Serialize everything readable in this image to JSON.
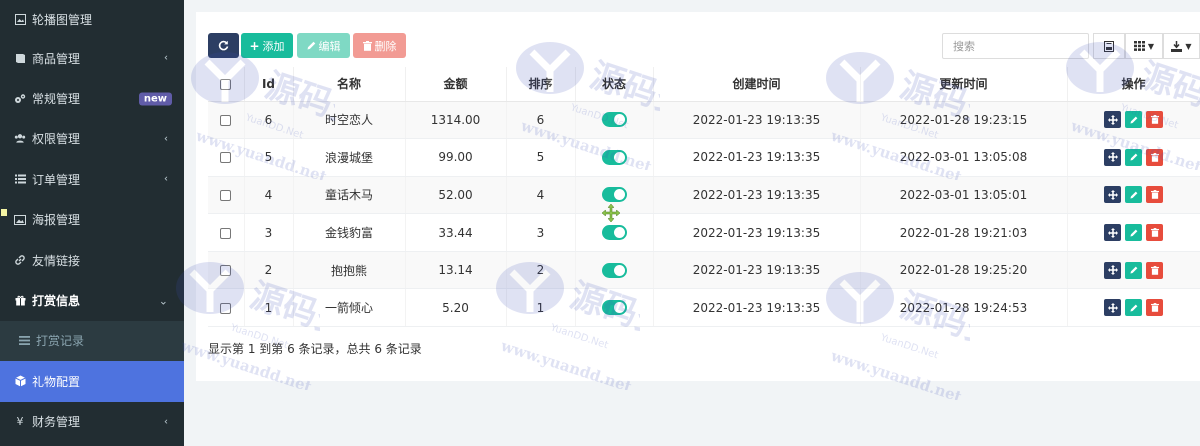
{
  "sidebar": {
    "items": [
      {
        "label": "轮播图管理",
        "icon": "image-icon",
        "chevron": false
      },
      {
        "label": "商品管理",
        "icon": "book-icon",
        "chevron": true
      },
      {
        "label": "常规管理",
        "icon": "gears-icon",
        "badge": "new"
      },
      {
        "label": "权限管理",
        "icon": "users-icon",
        "chevron": true
      },
      {
        "label": "订单管理",
        "icon": "list-icon",
        "chevron": true
      },
      {
        "label": "海报管理",
        "icon": "picture-icon",
        "chevron": false
      },
      {
        "label": "友情链接",
        "icon": "link-icon",
        "chevron": false
      },
      {
        "label": "打赏信息",
        "icon": "gift-icon",
        "chevron_down": true
      },
      {
        "label": "打赏记录",
        "icon": "list-icon"
      },
      {
        "label": "礼物配置",
        "icon": "cube-icon"
      },
      {
        "label": "财务管理",
        "icon": "yen-icon",
        "chevron": true
      }
    ]
  },
  "toolbar": {
    "add_label": "添加",
    "edit_label": "编辑",
    "delete_label": "删除",
    "search_placeholder": "搜索"
  },
  "table": {
    "columns": [
      "Id",
      "名称",
      "金额",
      "排序",
      "状态",
      "创建时间",
      "更新时间",
      "操作"
    ],
    "rows": [
      {
        "id": "6",
        "name": "时空恋人",
        "amount": "1314.00",
        "sort": "6",
        "status": true,
        "created": "2022-01-23 19:13:35",
        "updated": "2022-01-28 19:23:15"
      },
      {
        "id": "5",
        "name": "浪漫城堡",
        "amount": "99.00",
        "sort": "5",
        "status": true,
        "created": "2022-01-23 19:13:35",
        "updated": "2022-03-01 13:05:08"
      },
      {
        "id": "4",
        "name": "童话木马",
        "amount": "52.00",
        "sort": "4",
        "status": true,
        "created": "2022-01-23 19:13:35",
        "updated": "2022-03-01 13:05:01"
      },
      {
        "id": "3",
        "name": "金钱豹富",
        "amount": "33.44",
        "sort": "3",
        "status": true,
        "created": "2022-01-23 19:13:35",
        "updated": "2022-01-28 19:21:03"
      },
      {
        "id": "2",
        "name": "抱抱熊",
        "amount": "13.14",
        "sort": "2",
        "status": true,
        "created": "2022-01-23 19:13:35",
        "updated": "2022-01-28 19:25:20"
      },
      {
        "id": "1",
        "name": "一箭倾心",
        "amount": "5.20",
        "sort": "1",
        "status": true,
        "created": "2022-01-23 19:13:35",
        "updated": "2022-01-28 19:24:53"
      }
    ]
  },
  "pagination": {
    "summary": "显示第 1 到第 6 条记录，总共 6 条记录"
  },
  "watermark": {
    "text_cn": "源码多",
    "text_en": "YuanDD.Net",
    "url": "www.yuandd.net"
  },
  "colors": {
    "sidebar_bg": "#222d32",
    "active_item": "#4e73df",
    "primary": "#2c3e63",
    "success": "#18bc9c",
    "danger": "#e74c3c"
  }
}
